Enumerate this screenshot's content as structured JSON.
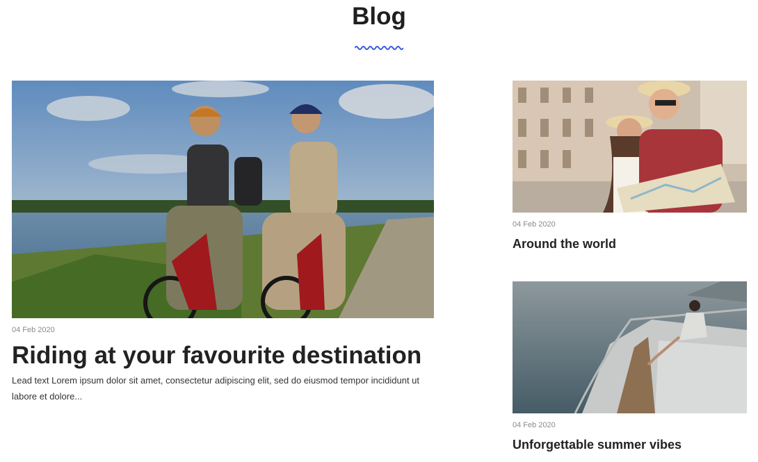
{
  "header": {
    "title": "Blog",
    "accent_color": "#3b5bdb"
  },
  "featured_post": {
    "image_icon": "bicycle-riders-photo",
    "date": "04 Feb 2020",
    "title": "Riding at your favourite destination",
    "lead": "Lead text Lorem ipsum dolor sit amet, consectetur adipiscing elit, sed do eiusmod tempor incididunt ut labore et dolore..."
  },
  "side_posts": [
    {
      "image_icon": "travel-couple-map-photo",
      "date": "04 Feb 2020",
      "title": "Around the world"
    },
    {
      "image_icon": "yacht-sea-photo",
      "date": "04 Feb 2020",
      "title": "Unforgettable summer vibes"
    }
  ]
}
